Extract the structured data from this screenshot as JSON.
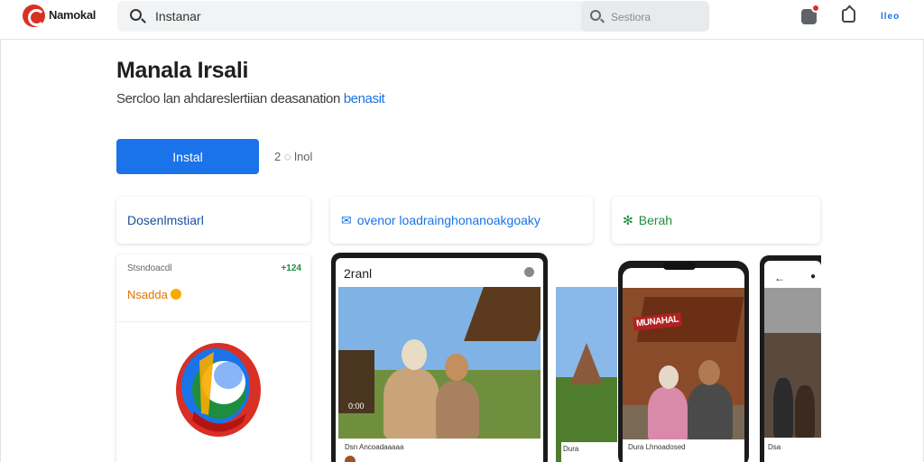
{
  "header": {
    "brand": "Namokal",
    "search_query": "Instanar",
    "secondary_search_placeholder": "Sestiora",
    "more_label": "lleo"
  },
  "app": {
    "title": "Manala Irsali",
    "subtitle": "Sercloo lan ahdareslertiian deasanation",
    "subtitle_link": "benasit",
    "install_label": "Instal",
    "share_label": "2 ◌ lnol"
  },
  "chips": [
    {
      "icon": "",
      "label": "Dosenlmstiarl"
    },
    {
      "icon": "✉",
      "label": "ovenor loadrainghonanoakgoaky"
    },
    {
      "icon": "✻",
      "label": "Berah"
    }
  ],
  "listing_card": {
    "caption": "Stsndoacdl",
    "count": "+124",
    "name": "Nsadda"
  },
  "screenshots": {
    "phone1_header": "2ranl",
    "phone1_time": "0:00",
    "phone1_footer": "Dsn Ancoadaaaaa",
    "temple_footer": "Dura",
    "phone2_sign": "MUNAHAL",
    "phone2_footer": "Dura Lhnoadosed",
    "phone3_back": "←",
    "phone3_footer": "Dsa"
  },
  "colors": {
    "accent": "#1a73e8",
    "brand_red": "#d93025",
    "green": "#1e8e3e",
    "orange": "#e37400"
  }
}
